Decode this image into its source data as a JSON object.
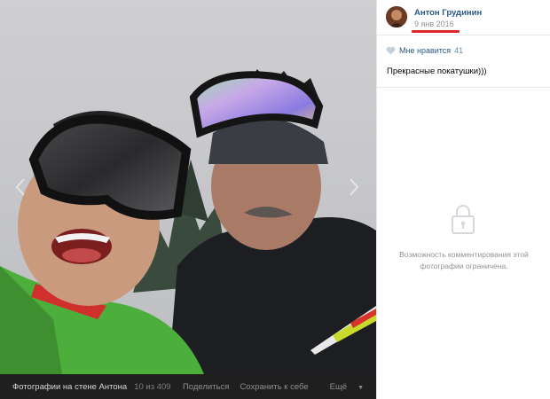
{
  "author": {
    "name": "Антон Грудинин",
    "date": "9 янв 2016",
    "accent": "#e0242b"
  },
  "likes": {
    "label": "Мне нравится",
    "count": "41",
    "icon": "heart-icon"
  },
  "caption": "Прекрасные покатушки)))",
  "comments": {
    "icon": "lock-icon",
    "restricted_line1": "Возможность комментирования этой",
    "restricted_line2": "фотографии ограничена."
  },
  "photo_bar": {
    "title": "Фотографии на стене Антона",
    "counter": "10 из 409",
    "share": "Поделиться",
    "save": "Сохранить к себе",
    "more": "Ещё"
  },
  "colors": {
    "link": "#2a5885",
    "muted": "#939393",
    "bar_bg": "#1f1f1f"
  }
}
